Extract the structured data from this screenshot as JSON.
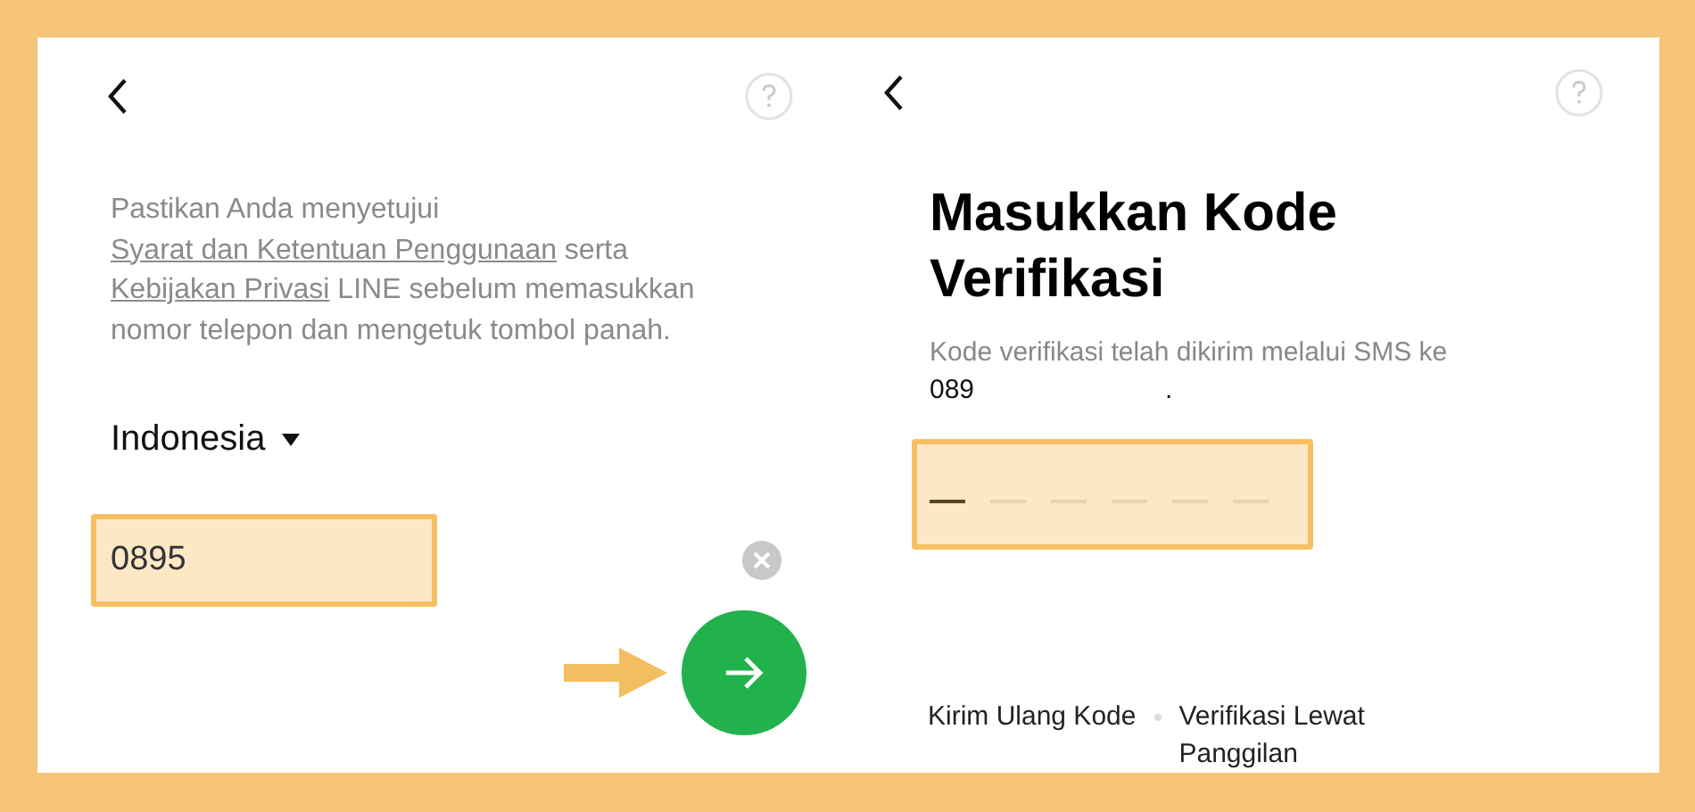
{
  "phone_screen": {
    "notice": [
      {
        "kind": "plain",
        "text": "Pastikan Anda menyetujui "
      },
      {
        "kind": "link",
        "text": "Syarat dan Ketentuan Penggunaan"
      },
      {
        "kind": "plain",
        "text": " serta "
      },
      {
        "kind": "link",
        "text": "Kebijakan Privasi"
      },
      {
        "kind": "plain",
        "text": " LINE sebelum memasukkan nomor telepon dan mengetuk tombol panah."
      }
    ],
    "country": "Indonesia",
    "phone_field": {
      "value": "0895"
    }
  },
  "code_screen": {
    "title": "Masukkan Kode Verifikasi",
    "subtitle": "Kode verifikasi telah dikirim melalui SMS ke",
    "number": "089",
    "number_end": ".",
    "slots": [
      {
        "selected": true
      },
      {
        "selected": false
      },
      {
        "selected": false
      },
      {
        "selected": false
      },
      {
        "selected": false
      },
      {
        "selected": false
      }
    ],
    "links": [
      "Kirim Ulang Kode",
      "Verifikasi Lewat Panggilan"
    ]
  }
}
